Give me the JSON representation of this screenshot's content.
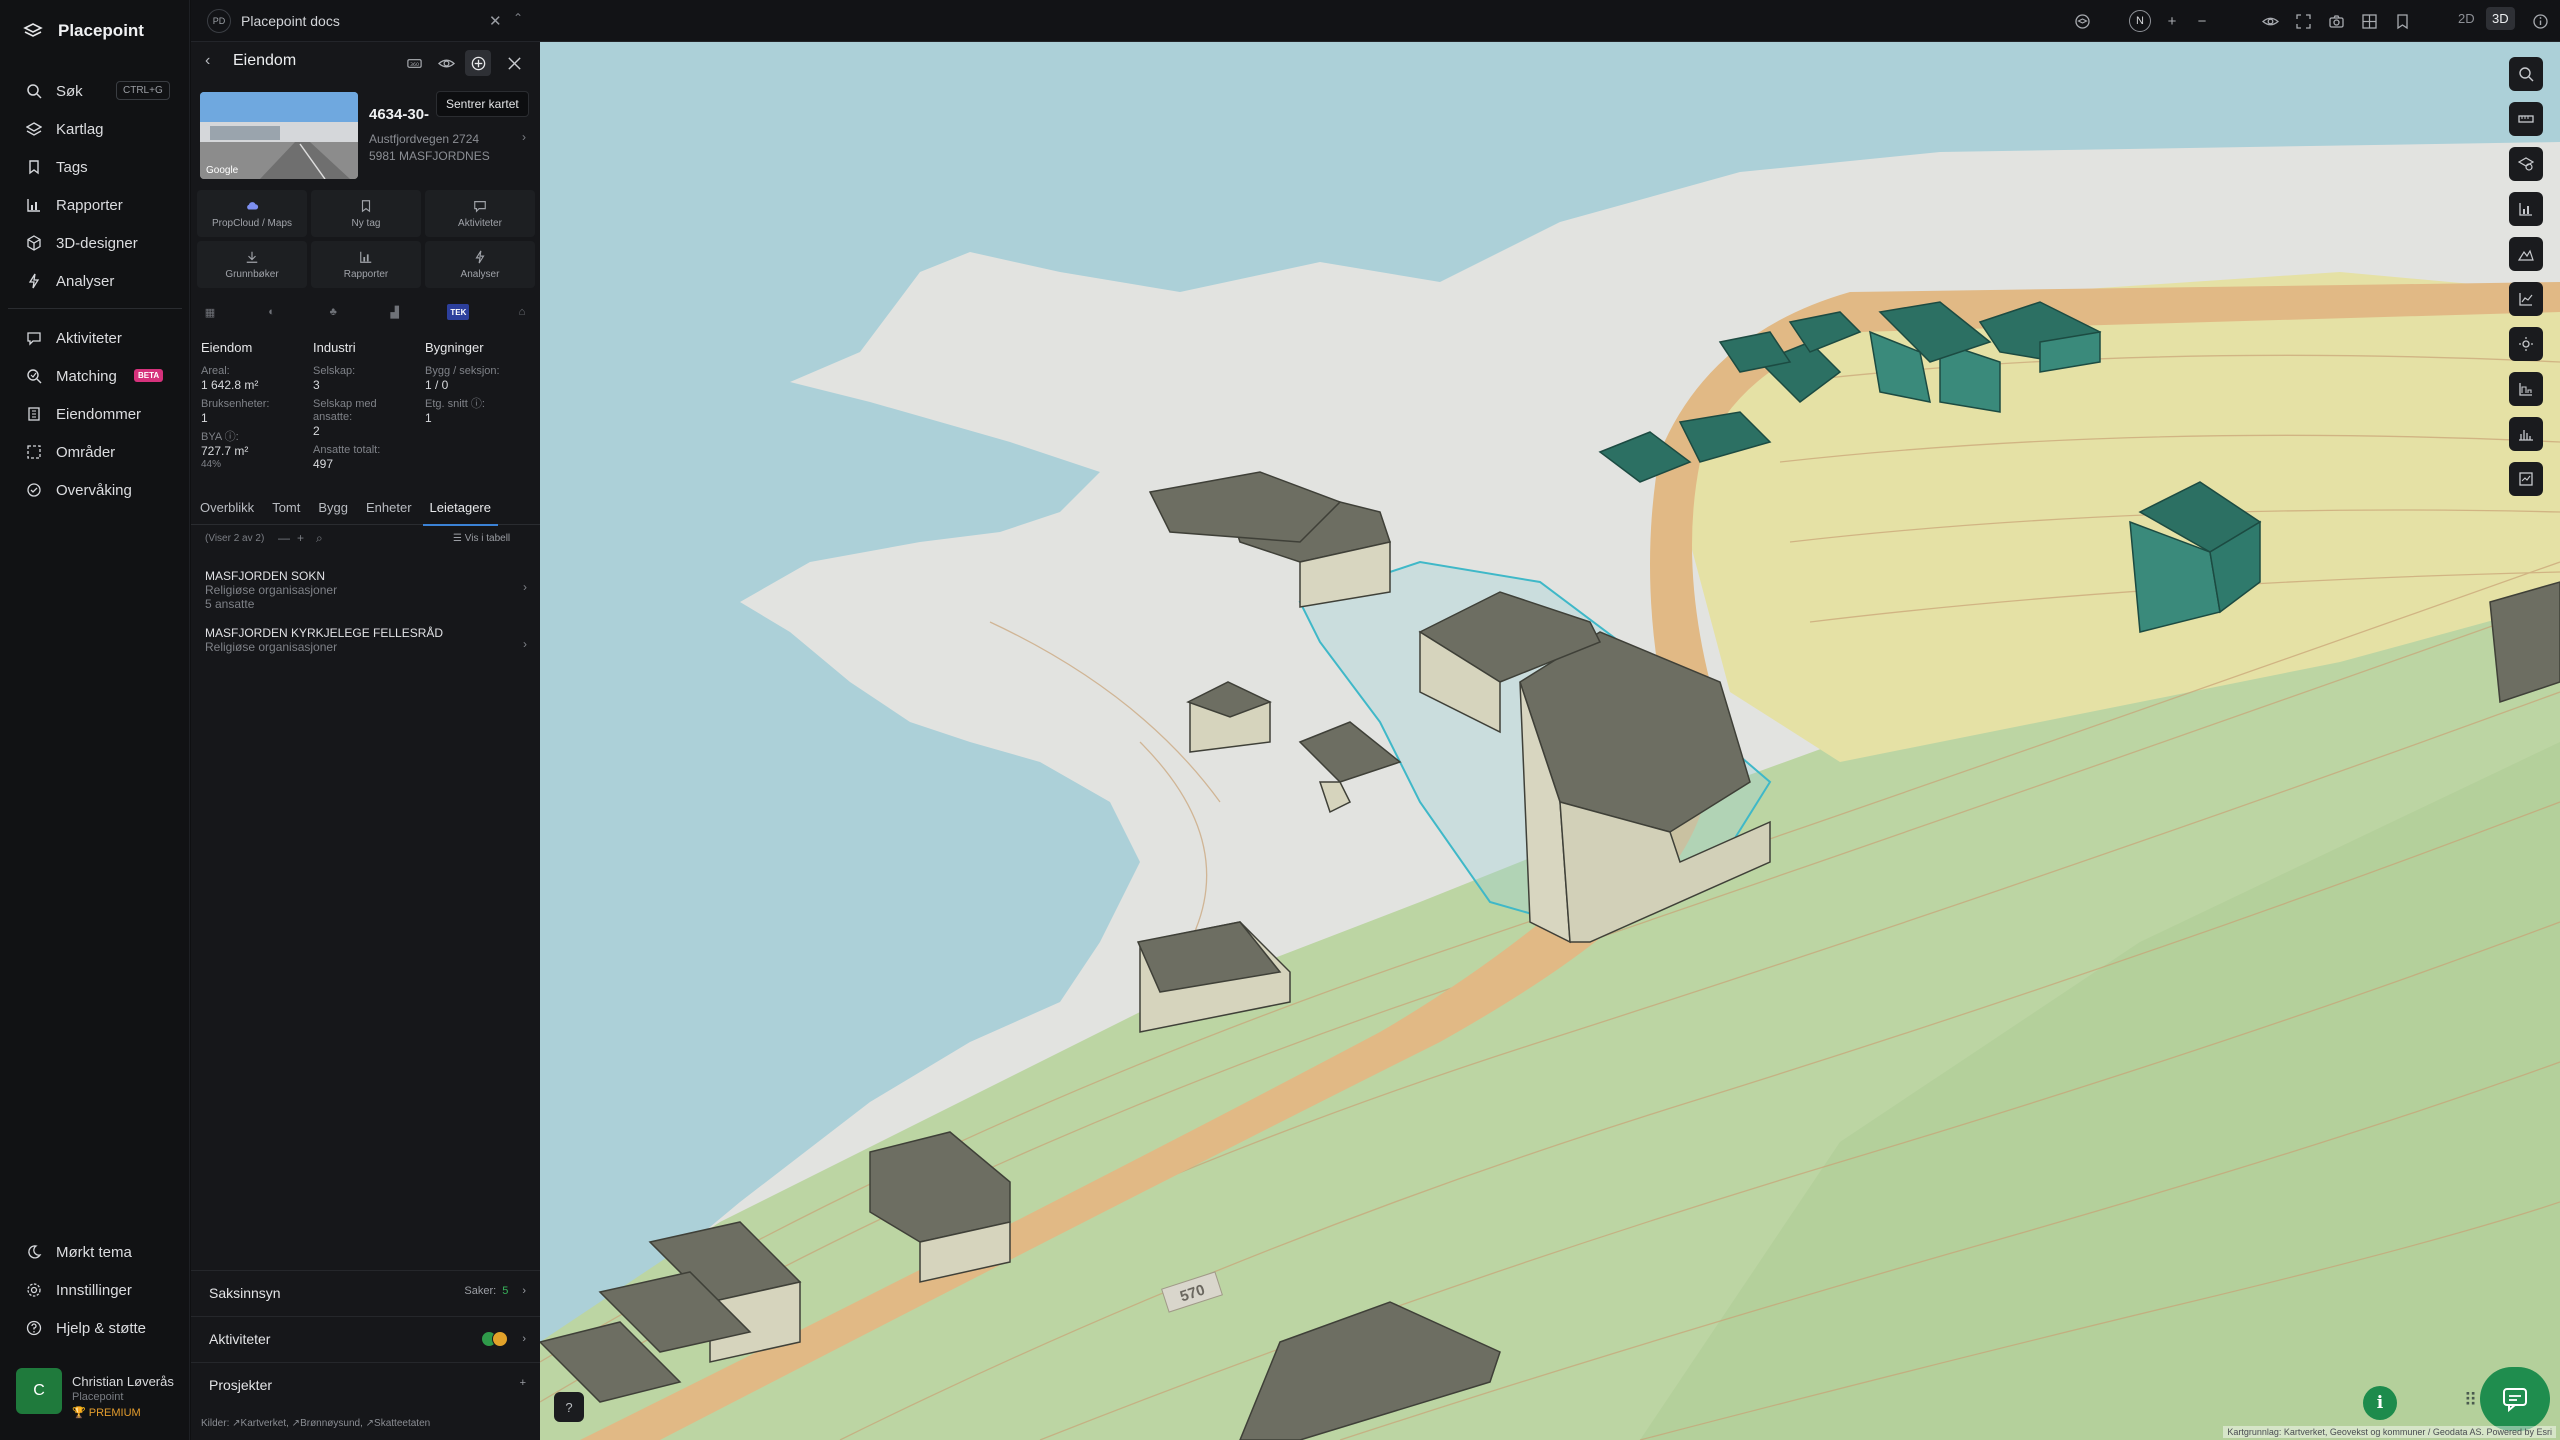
{
  "app": {
    "brand": "Placepoint"
  },
  "nav": {
    "items": [
      {
        "label": "Søk",
        "icon": "search-icon",
        "shortcut": "CTRL+G"
      },
      {
        "label": "Kartlag",
        "icon": "layers-icon"
      },
      {
        "label": "Tags",
        "icon": "bookmark-icon"
      },
      {
        "label": "Rapporter",
        "icon": "bar-chart-icon"
      },
      {
        "label": "3D-designer",
        "icon": "cube-icon"
      },
      {
        "label": "Analyser",
        "icon": "lightning-icon"
      }
    ],
    "items2": [
      {
        "label": "Aktiviteter",
        "icon": "activity-icon"
      },
      {
        "label": "Matching",
        "icon": "matching-icon",
        "badge": "BETA"
      },
      {
        "label": "Eiendommer",
        "icon": "building-icon"
      },
      {
        "label": "Områder",
        "icon": "area-icon"
      },
      {
        "label": "Overvåking",
        "icon": "monitor-icon"
      }
    ],
    "bottom": [
      {
        "label": "Mørkt tema",
        "icon": "moon-icon"
      },
      {
        "label": "Innstillinger",
        "icon": "gear-icon"
      },
      {
        "label": "Hjelp & støtte",
        "icon": "help-icon"
      }
    ],
    "user": {
      "initial": "C",
      "name": "Christian Løverås",
      "org": "Placepoint",
      "plan": "PREMIUM"
    }
  },
  "doc_tab": {
    "badge": "PD",
    "title": "Placepoint docs"
  },
  "panel": {
    "title": "Eiendom",
    "tooltip": "Sentrer kartet",
    "property": {
      "id": "4634-30-",
      "address_line1": "Austfjordvegen 2724",
      "address_line2": "5981 MASFJORDNES",
      "image_label": "Google"
    },
    "actions": [
      {
        "label": "PropCloud / Maps",
        "icon": "cloud-icon"
      },
      {
        "label": "Ny tag",
        "icon": "bookmark-icon"
      },
      {
        "label": "Aktiviteter",
        "icon": "chat-icon"
      },
      {
        "label": "Grunnbøker",
        "icon": "download-icon"
      },
      {
        "label": "Rapporter",
        "icon": "bar-chart-icon"
      },
      {
        "label": "Analyser",
        "icon": "lightning-icon"
      }
    ],
    "tek_label": "TEK",
    "stats": {
      "eiendom": {
        "heading": "Eiendom",
        "areal_label": "Areal:",
        "areal_value": "1 642.8 m²",
        "bruks_label": "Bruksenheter:",
        "bruks_value": "1",
        "bya_label": "BYA ⓘ:",
        "bya_value": "727.7 m²",
        "bya_pct": "44%"
      },
      "industri": {
        "heading": "Industri",
        "selskap_label": "Selskap:",
        "selskap_value": "3",
        "ansatte_label": "Selskap med ansatte:",
        "ansatte_value": "2",
        "totalt_label": "Ansatte totalt:",
        "totalt_value": "497"
      },
      "bygninger": {
        "heading": "Bygninger",
        "bygg_label": "Bygg / seksjon:",
        "bygg_value": "1 / 0",
        "etg_label": "Etg. snitt ⓘ:",
        "etg_value": "1"
      }
    },
    "tabs": [
      "Overblikk",
      "Tomt",
      "Bygg",
      "Enheter",
      "Leietagere"
    ],
    "active_tab": "Leietagere",
    "list": {
      "count_label": "(Viser 2 av 2)",
      "table_label": "Vis i tabell",
      "items": [
        {
          "name": "MASFJORDEN SOKN",
          "sub": "Religiøse organisasjoner",
          "sub2": "5 ansatte"
        },
        {
          "name": "MASFJORDEN KYRKJELEGE FELLESRÅD",
          "sub": "Religiøse organisasjoner",
          "sub2": ""
        }
      ]
    },
    "sections": {
      "saksinnsyn": {
        "title": "Saksinnsyn",
        "count_label": "Saker:",
        "count": "5"
      },
      "aktiviteter": {
        "title": "Aktiviteter"
      },
      "prosjekter": {
        "title": "Prosjekter",
        "action": "+"
      }
    },
    "sources_label": "Kilder:",
    "sources": [
      "Kartverket",
      "Brønnøysund",
      "Skatteetaten"
    ]
  },
  "topbar": {
    "compass": "N",
    "view_2d": "2D",
    "view_3d": "3D"
  },
  "map": {
    "road_label": "570",
    "attribution": "Kartgrunnlag: Kartverket, Geovekst og kommuner / Geodata AS. Powered by Esri",
    "colors": {
      "water": "#acd0d8",
      "road": "#e1b985",
      "field": "#e6e2a6",
      "terrain": "#bfd7a6",
      "building": "#6d6e62",
      "highlighted_building": "#2c7063",
      "accent": "#1f8d4e"
    }
  }
}
